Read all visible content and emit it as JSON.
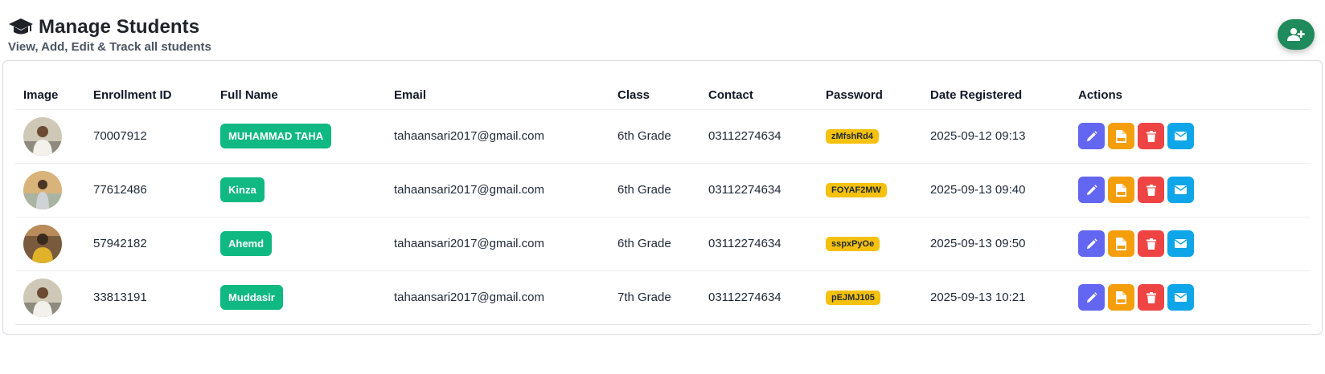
{
  "header": {
    "title": "Manage Students",
    "subtitle": "View, Add, Edit & Track all students"
  },
  "icons": {
    "title_icon": "graduation-cap-icon",
    "add_button_icon": "user-plus-icon",
    "edit": "pencil-icon",
    "pdf": "pdf-file-icon",
    "delete": "trash-icon",
    "email": "envelope-icon"
  },
  "colors": {
    "add_button": "#1f8a5b",
    "name_badge": "#10b981",
    "password_badge": "#f5c10f",
    "edit": "#6366f1",
    "pdf": "#f59e0b",
    "delete": "#ef4444",
    "email": "#0ea5e9"
  },
  "table": {
    "columns": [
      "Image",
      "Enrollment ID",
      "Full Name",
      "Email",
      "Class",
      "Contact",
      "Password",
      "Date Registered",
      "Actions"
    ],
    "rows": [
      {
        "enrollment_id": "70007912",
        "full_name": "MUHAMMAD TAHA",
        "email": "tahaansari2017@gmail.com",
        "class": "6th Grade",
        "contact": "03112274634",
        "password": "zMfshRd4",
        "date_registered": "2025-09-12 09:13"
      },
      {
        "enrollment_id": "77612486",
        "full_name": "Kinza",
        "email": "tahaansari2017@gmail.com",
        "class": "6th Grade",
        "contact": "03112274634",
        "password": "FOYAF2MW",
        "date_registered": "2025-09-13 09:40"
      },
      {
        "enrollment_id": "57942182",
        "full_name": "Ahemd",
        "email": "tahaansari2017@gmail.com",
        "class": "6th Grade",
        "contact": "03112274634",
        "password": "sspxPyOe",
        "date_registered": "2025-09-13 09:50"
      },
      {
        "enrollment_id": "33813191",
        "full_name": "Muddasir",
        "email": "tahaansari2017@gmail.com",
        "class": "7th Grade",
        "contact": "03112274634",
        "password": "pEJMJ105",
        "date_registered": "2025-09-13 10:21"
      }
    ]
  }
}
